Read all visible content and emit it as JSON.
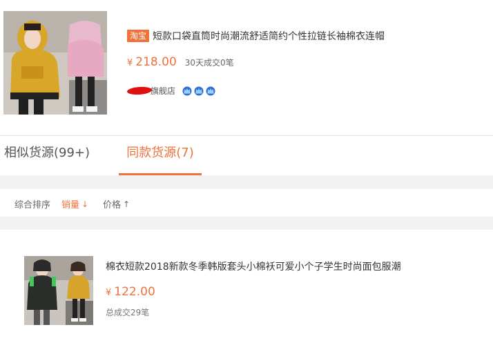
{
  "top_product": {
    "badge": "淘宝",
    "title": "短款口袋直筒时尚潮流舒适简约个性拉链长袖棉衣连帽",
    "price_symbol": "¥",
    "price": "218.00",
    "sales": "30天成交0笔",
    "shop_name": "旗舰店",
    "shop_level_icon": "crown-icon",
    "crown_count": 3
  },
  "tabs": {
    "similar": "相似货源(99+)",
    "same": "同款货源(7)"
  },
  "sort": {
    "comprehensive": "综合排序",
    "sales": "销量",
    "sales_arrow": "↓",
    "price": "价格",
    "price_arrow": "↑"
  },
  "results": [
    {
      "title": "棉衣短款2018新款冬季韩版套头小棉袄可爱小个子学生时尚面包服潮",
      "price_symbol": "¥",
      "price": "122.00",
      "sales": "总成交29笔"
    }
  ],
  "colors": {
    "accent": "#f0713a",
    "band": "#f2f2f2"
  }
}
